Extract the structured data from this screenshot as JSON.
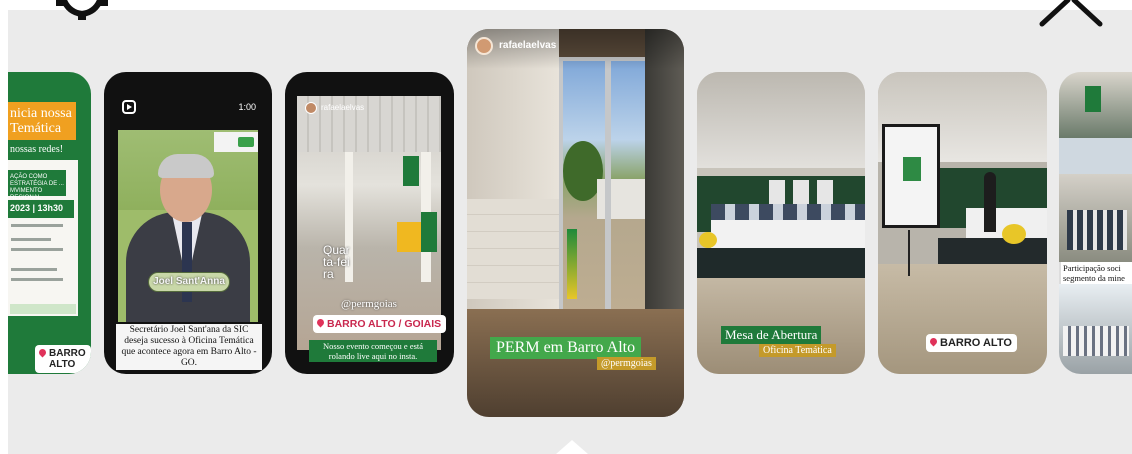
{
  "viewer": {
    "icons": {
      "settings": "gear-icon",
      "close": "close-icon"
    }
  },
  "stories": {
    "s1": {
      "poster_title": "nicia nossa Temática",
      "poster_sub": "nossas redes!",
      "poster_heading": "AÇÃO COMO ESTRATÉGIA DE ... MVIMENTO REGIONAL",
      "poster_date": "2023 | 13h30",
      "location": "BARRO ALTO"
    },
    "s2": {
      "time": "1:00",
      "name_tag": "Joel Sant'Anna",
      "caption": "Secretário Joel Sant'ana da SIC deseja sucesso à Oficina Temática que acontece agora em Barro Alto - GO."
    },
    "s3": {
      "username": "rafaelaelvas",
      "day": "Quar ta-fei ra",
      "handle": "@permgoias",
      "location": "BARRO ALTO / GOIAIS",
      "caption": "Nosso evento começou e está rolando live aqui no insta."
    },
    "s4": {
      "username": "rafaelaelvas",
      "title": "PERM em Barro Alto",
      "handle": "@permgoias"
    },
    "s5": {
      "title": "Mesa de Abertura",
      "subtitle": "Oficina Temática"
    },
    "s6": {
      "location": "BARRO ALTO"
    },
    "s7": {
      "caption": "Participação soci segmento da mine"
    }
  }
}
